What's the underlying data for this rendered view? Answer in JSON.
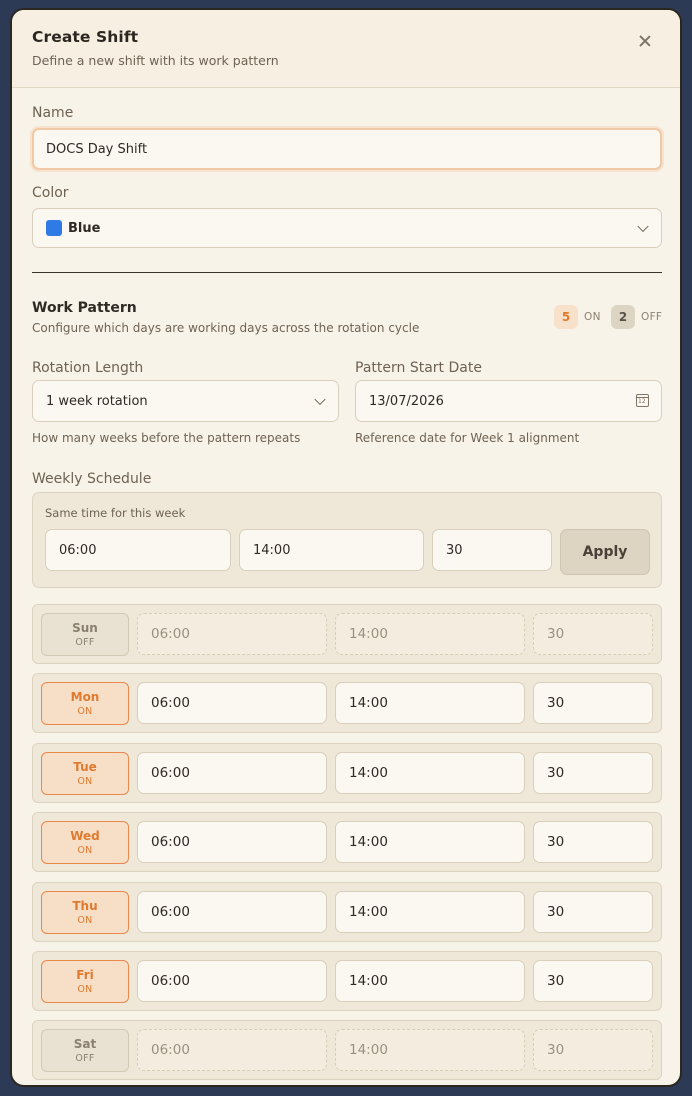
{
  "modal": {
    "title": "Create Shift",
    "subtitle": "Define a new shift with its work pattern"
  },
  "name_field": {
    "label": "Name",
    "value": "DOCS Day Shift"
  },
  "color_field": {
    "label": "Color",
    "value": "Blue",
    "swatch_color": "#2f7ae5"
  },
  "work_pattern": {
    "title": "Work Pattern",
    "subtitle": "Configure which days are working days across the rotation cycle",
    "on_count": "5",
    "on_label": "ON",
    "off_count": "2",
    "off_label": "OFF"
  },
  "rotation": {
    "label": "Rotation Length",
    "value": "1 week rotation",
    "hint": "How many weeks before the pattern repeats"
  },
  "start_date": {
    "label": "Pattern Start Date",
    "value": "13/07/2026",
    "hint": "Reference date for Week 1 alignment"
  },
  "weekly": {
    "label": "Weekly Schedule",
    "same_time_label": "Same time for this week",
    "start": "06:00",
    "end": "14:00",
    "break": "30",
    "apply_label": "Apply"
  },
  "days": [
    {
      "name": "Sun",
      "state": "OFF",
      "on": false,
      "start": "06:00",
      "end": "14:00",
      "break": "30"
    },
    {
      "name": "Mon",
      "state": "ON",
      "on": true,
      "start": "06:00",
      "end": "14:00",
      "break": "30"
    },
    {
      "name": "Tue",
      "state": "ON",
      "on": true,
      "start": "06:00",
      "end": "14:00",
      "break": "30"
    },
    {
      "name": "Wed",
      "state": "ON",
      "on": true,
      "start": "06:00",
      "end": "14:00",
      "break": "30"
    },
    {
      "name": "Thu",
      "state": "ON",
      "on": true,
      "start": "06:00",
      "end": "14:00",
      "break": "30"
    },
    {
      "name": "Fri",
      "state": "ON",
      "on": true,
      "start": "06:00",
      "end": "14:00",
      "break": "30"
    },
    {
      "name": "Sat",
      "state": "OFF",
      "on": false,
      "start": "06:00",
      "end": "14:00",
      "break": "30"
    }
  ],
  "colors": {
    "accent_orange": "#e07a2f",
    "on_bg": "#f7dfc7",
    "panel_bg": "#f8f3e8"
  }
}
